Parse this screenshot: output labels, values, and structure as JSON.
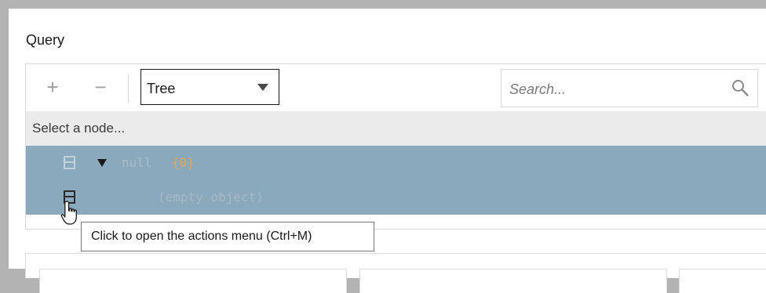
{
  "query": {
    "label": "Query"
  },
  "toolbar": {
    "expand_icon": "plus-icon",
    "collapse_icon": "minus-icon",
    "mode": {
      "selected": "Tree"
    },
    "search": {
      "placeholder": "Search...",
      "icon": "search-icon"
    }
  },
  "navigation": {
    "text": "Select a node..."
  },
  "tree": {
    "root": {
      "field": "null",
      "count": "{0}"
    },
    "child": {
      "text": "(empty object)"
    }
  },
  "tooltip": {
    "text": "Click to open the actions menu (Ctrl+M)"
  },
  "colors": {
    "selection": "#8aa9bd",
    "count": "#e8a64c",
    "navbar": "#ebebeb"
  }
}
